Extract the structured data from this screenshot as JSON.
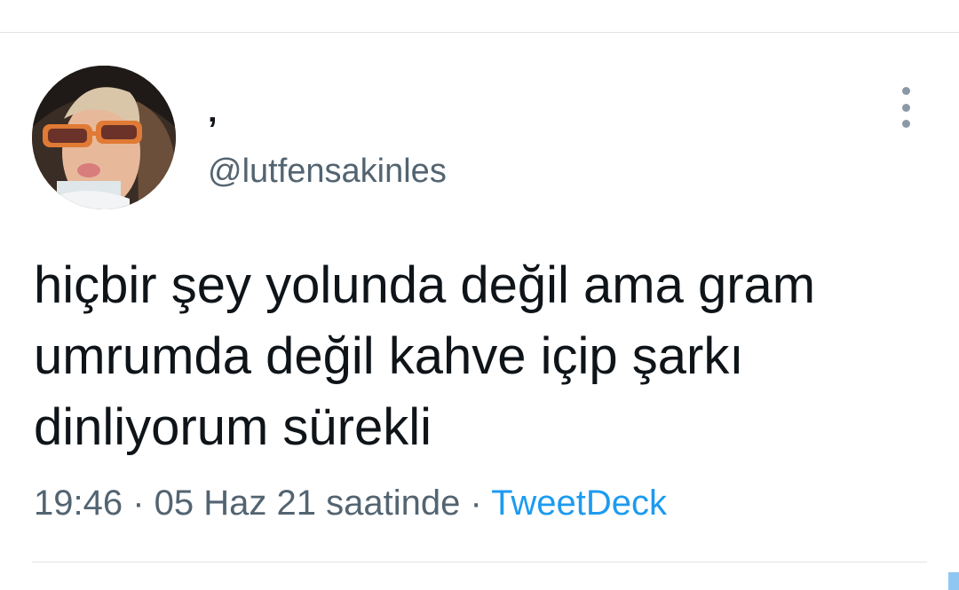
{
  "tweet": {
    "display_name": "‚",
    "handle": "@lutfensakinles",
    "text": "hiçbir şey yolunda değil ama gram\numrumda değil kahve içip şarkı\ndinliyorum sürekli",
    "time": "19:46",
    "separator": " · ",
    "date": "05 Haz 21 saatinde",
    "source": "TweetDeck"
  },
  "icons": {
    "more": "more-vertical-icon"
  },
  "colors": {
    "text": "#0f1419",
    "secondary": "#536471",
    "link": "#1d9bf0",
    "divider": "#dfe3e6"
  }
}
